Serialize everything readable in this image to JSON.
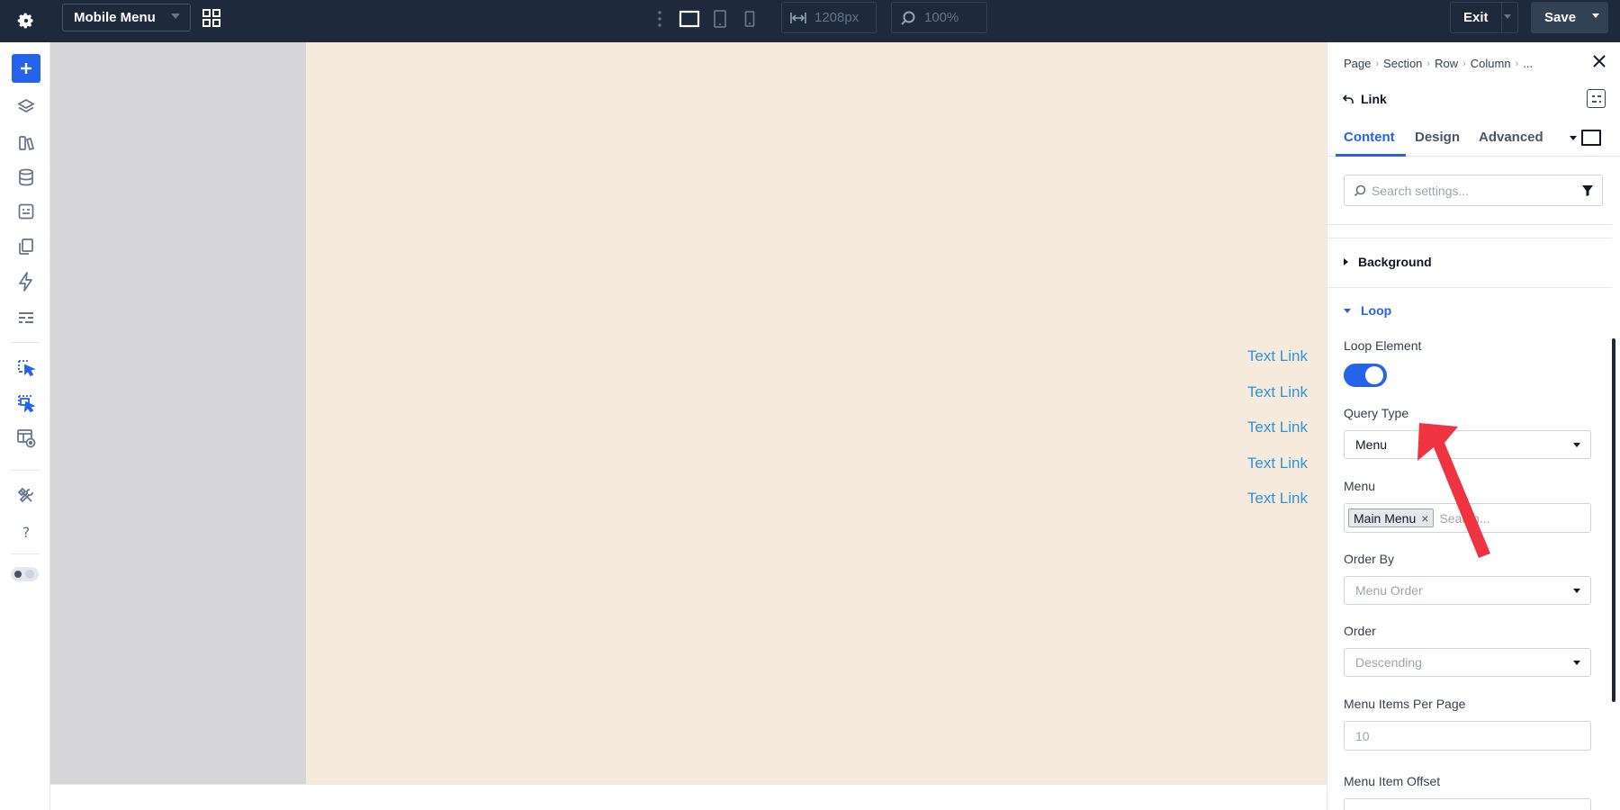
{
  "topbar": {
    "page_select": "Mobile Menu",
    "width_value": "1208px",
    "zoom_value": "100%",
    "exit_label": "Exit",
    "save_label": "Save"
  },
  "canvas": {
    "links": [
      "Text Link",
      "Text Link",
      "Text Link",
      "Text Link",
      "Text Link"
    ],
    "link_color": "#2e94d8",
    "beige": "#f6eadd"
  },
  "panel": {
    "breadcrumbs": [
      "Page",
      "Section",
      "Row",
      "Column",
      "..."
    ],
    "element_title": "Link",
    "tabs": [
      "Content",
      "Design",
      "Advanced"
    ],
    "active_tab": "Content",
    "search_placeholder": "Search settings...",
    "groups": {
      "background": "Background",
      "loop": "Loop"
    },
    "loop": {
      "loop_element_label": "Loop Element",
      "loop_element_on": true,
      "query_type_label": "Query Type",
      "query_type_value": "Menu",
      "menu_label": "Menu",
      "menu_tag": "Main Menu",
      "menu_search_placeholder": "Search...",
      "order_by_label": "Order By",
      "order_by_value": "Menu Order",
      "order_label": "Order",
      "order_value": "Descending",
      "per_page_label": "Menu Items Per Page",
      "per_page_placeholder": "10",
      "offset_label": "Menu Item Offset"
    }
  },
  "colors": {
    "accent": "#2563eb",
    "topbar": "#1e293b",
    "arrow": "#ef3340"
  }
}
